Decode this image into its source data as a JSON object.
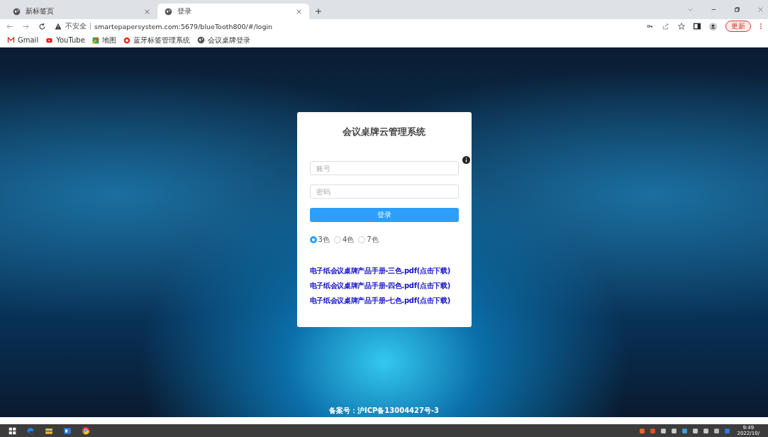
{
  "browser": {
    "tabs": [
      {
        "title": "新标签页",
        "selected": false
      },
      {
        "title": "登录",
        "selected": true
      }
    ],
    "address": {
      "security": "不安全",
      "url": "smartepapersystem.com:5679/blueTooth800/#/login"
    },
    "update_button": "更新",
    "bookmarks": [
      "Gmail",
      "YouTube",
      "地图",
      "蓝牙标签管理系统",
      "会议桌牌登录"
    ]
  },
  "login": {
    "title": "会议桌牌云管理系统",
    "account_placeholder": "账号",
    "password_placeholder": "密码",
    "submit": "登录",
    "color_options": [
      {
        "label": "3色",
        "selected": true
      },
      {
        "label": "4色",
        "selected": false
      },
      {
        "label": "7色",
        "selected": false
      }
    ],
    "downloads": [
      "电子纸会议桌牌产品手册-三色.pdf(点击下载)",
      "电子纸会议桌牌产品手册-四色.pdf(点击下载)",
      "电子纸会议桌牌产品手册-七色.pdf(点击下载)"
    ]
  },
  "footer": "备案号：沪ICP备13004427号-3",
  "taskbar": {
    "time": "9:49",
    "date": "2022/10/"
  }
}
